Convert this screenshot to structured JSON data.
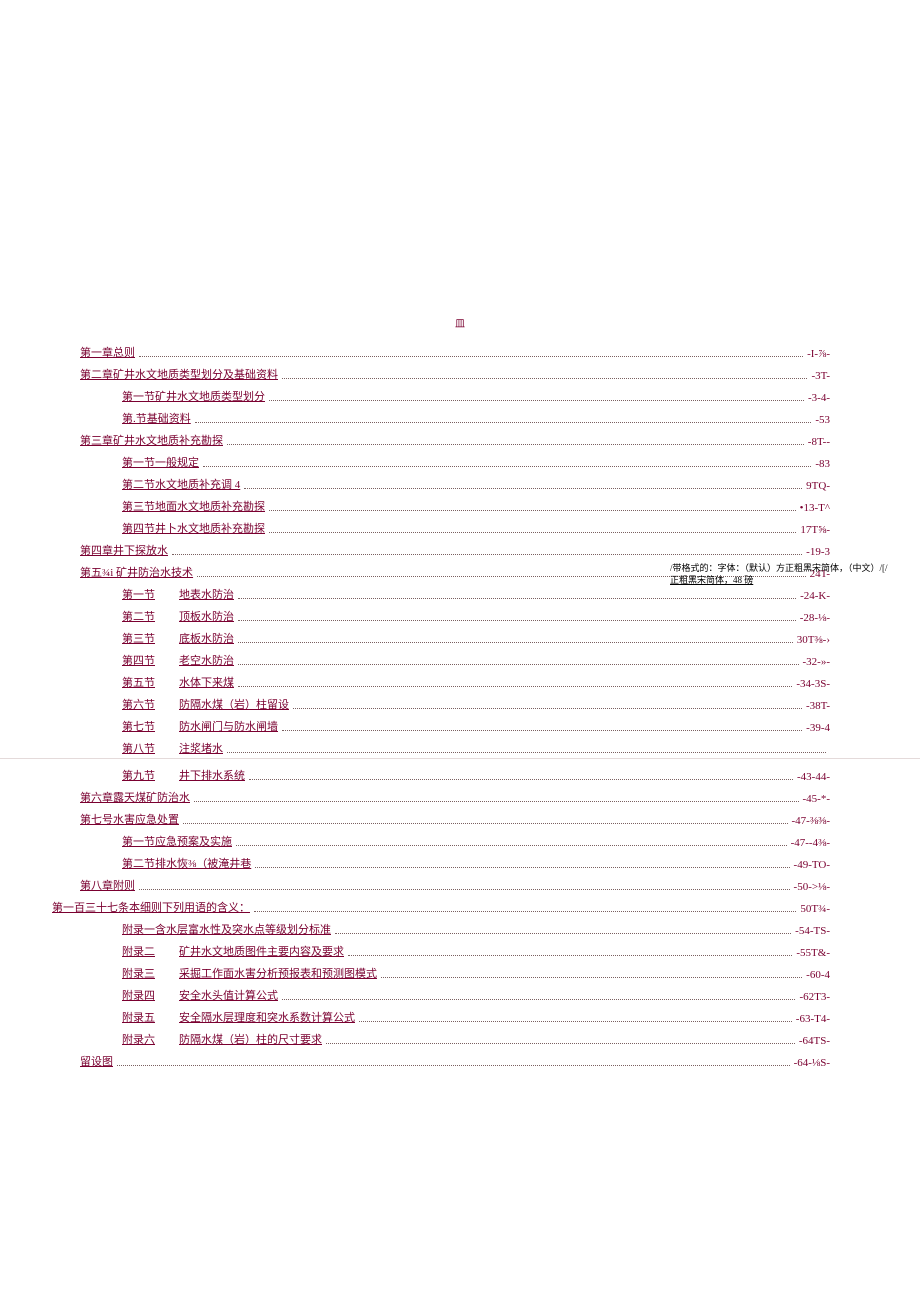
{
  "format_note": {
    "prefix": "/带格式的：字体：（默认）方正粗黑宋简体，（中文）/[/",
    "link": "正粗黑宋简体，48  磅"
  },
  "toc_header": "皿",
  "entries": [
    {
      "indent": 0,
      "label": "第一章总则",
      "page": "-I-⅞-"
    },
    {
      "indent": 0,
      "label": "第二章矿井水文地质类型划分及基础资料",
      "page": "-3T-"
    },
    {
      "indent": 1,
      "label": "第一节矿井水文地质类型划分",
      "page": "-3-4-"
    },
    {
      "indent": 1,
      "label": "第.节基础资料",
      "page": "-53"
    },
    {
      "indent": 0,
      "label": "第三章矿井水文地质补充勘探",
      "page": "-8T--"
    },
    {
      "indent": 1,
      "label": "第一节一般规定",
      "page": "-83"
    },
    {
      "indent": 1,
      "label": "第二节水文地质补充调 4",
      "page": "9TQ-"
    },
    {
      "indent": 1,
      "label": "第三节地面水文地质补充勘探",
      "page": "•13-T^"
    },
    {
      "indent": 1,
      "label": "第四节井卜水文地质补充勘探",
      "page": "17T⅝-"
    },
    {
      "indent": 0,
      "label": "第四章井下探放水",
      "page": "-19-3"
    },
    {
      "indent": 0,
      "label": "第五¾i 矿井防治水技术",
      "page": "24T-"
    },
    {
      "indent": 1,
      "seg1": "第一节",
      "seg2": "地表水防治",
      "page": "-24-K-"
    },
    {
      "indent": 1,
      "seg1": "第二节",
      "seg2": "顶板水防治",
      "page": "-28-⅛-"
    },
    {
      "indent": 1,
      "seg1": "第三节",
      "seg2": "底板水防治",
      "page": "30T⅜-›"
    },
    {
      "indent": 1,
      "seg1": "第四节",
      "seg2": "老空水防治",
      "page": "-32-»-"
    },
    {
      "indent": 1,
      "seg1": "第五节",
      "seg2": "水体下来煤",
      "page": "-34-3S-"
    },
    {
      "indent": 1,
      "seg1": "第六节",
      "seg2": "防隔水煤（岩）柱留设",
      "page": "-38T-"
    },
    {
      "indent": 1,
      "seg1": "第七节",
      "seg2": "防水闸门与防水闸墙",
      "page": "-39-4"
    },
    {
      "indent": 1,
      "seg1": "第八节",
      "seg2": "注浆堵水",
      "page": "",
      "sep_after": true
    },
    {
      "indent": 1,
      "seg1": "第九节",
      "seg2": "井下排水系统",
      "page": "-43-44-"
    },
    {
      "indent": 0,
      "label": "第六章露天煤矿防治水",
      "page": "-45-*-"
    },
    {
      "indent": 0,
      "label": "第七号水害应急处置",
      "page": "-47-⅜⅜-"
    },
    {
      "indent": 1,
      "label": "第一节应急预案及实施",
      "page": "-47--4⅜-"
    },
    {
      "indent": 1,
      "label": "第二节排水恢⅜（被淹井巷",
      "page": "-49-TO-"
    },
    {
      "indent": 0,
      "label": "第八章附则",
      "page": "-50->⅛-"
    },
    {
      "indent": 0,
      "label": "第一百三十七条本细则下列用语的含义：",
      "page": "50T¾-",
      "outdent": true
    },
    {
      "indent": 1,
      "label": "附录一含水层富水性及突水点等级划分标准",
      "page": "-54-TS-"
    },
    {
      "indent": 1,
      "seg1": "附录二",
      "seg2": "矿井水文地质图件主要内容及要求",
      "page": "-55T&-"
    },
    {
      "indent": 1,
      "seg1": "附录三",
      "seg2": "采掘工作面水害分析预报表和预测图模式",
      "page": "-60-4"
    },
    {
      "indent": 1,
      "seg1": "附录四",
      "seg2": "安全水头值计算公式",
      "page": "-62T3-"
    },
    {
      "indent": 1,
      "seg1": "附录五",
      "seg2": "安全隔水层理度和突水系数计算公式",
      "page": "-63-T4-"
    },
    {
      "indent": 1,
      "seg1": "附录六",
      "seg2": "防隔水煤（岩）柱的尺寸要求",
      "page": "-64TS-"
    },
    {
      "indent": 0,
      "label": "留设图",
      "page": "-64-⅛S-"
    }
  ]
}
